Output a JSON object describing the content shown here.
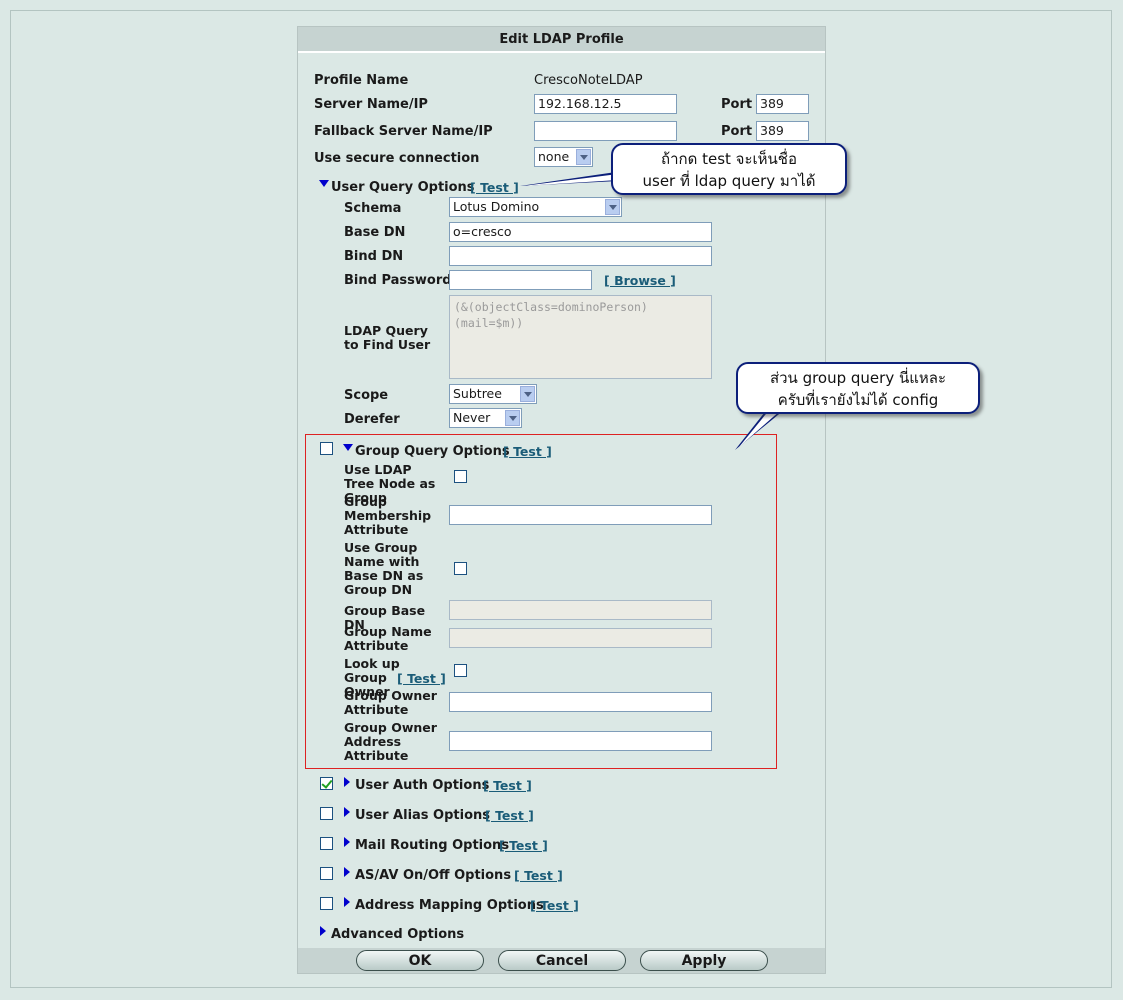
{
  "panel": {
    "title": "Edit LDAP Profile"
  },
  "fields": {
    "profile_name_label": "Profile Name",
    "profile_name_value": "CrescoNoteLDAP",
    "server_label": "Server Name/IP",
    "server_value": "192.168.12.5",
    "port_label": "Port",
    "port_value": "389",
    "fallback_label": "Fallback Server Name/IP",
    "fallback_value": "",
    "fallback_port_label": "Port",
    "fallback_port_value": "389",
    "secure_label": "Use secure connection",
    "secure_value": "none"
  },
  "user_query": {
    "title": "User Query Options",
    "test": "[ Test ]",
    "schema_label": "Schema",
    "schema_value": "Lotus Domino",
    "base_dn_label": "Base DN",
    "base_dn_value": "o=cresco",
    "bind_dn_label": "Bind DN",
    "bind_dn_value": "",
    "bind_pw_label": "Bind Password",
    "bind_pw_value": "",
    "browse": "[ Browse ]",
    "query_label": "LDAP Query to Find User",
    "query_value": "(&(objectClass=dominoPerson)\n(mail=$m))",
    "scope_label": "Scope",
    "scope_value": "Subtree",
    "derefer_label": "Derefer",
    "derefer_value": "Never"
  },
  "group_query": {
    "title": "Group Query Options",
    "test": "[ Test ]",
    "tree_node_label": "Use LDAP Tree Node as Group",
    "membership_label": "Group Membership Attribute",
    "membership_value": "",
    "use_name_label": "Use Group Name with Base DN as Group DN",
    "base_dn_label": "Group Base DN",
    "base_dn_value": "",
    "name_attr_label": "Group Name Attribute",
    "name_attr_value": "",
    "lookup_owner_label": "Look up Group Owner",
    "lookup_owner_test": "[ Test ]",
    "owner_attr_label": "Group Owner Attribute",
    "owner_attr_value": "",
    "owner_addr_label": "Group Owner Address Attribute",
    "owner_addr_value": ""
  },
  "sections": [
    {
      "title": "User Auth Options",
      "test": "[ Test ]",
      "checked": true
    },
    {
      "title": "User Alias Options",
      "test": "[ Test ]",
      "checked": false
    },
    {
      "title": "Mail Routing Options",
      "test": "[ Test ]",
      "checked": false
    },
    {
      "title": "AS/AV On/Off Options",
      "test": "[ Test ]",
      "checked": false
    },
    {
      "title": "Address Mapping Options",
      "test": "[ Test ]",
      "checked": false
    }
  ],
  "advanced": {
    "title": "Advanced Options"
  },
  "buttons": {
    "ok": "OK",
    "cancel": "Cancel",
    "apply": "Apply"
  },
  "callouts": {
    "test_note_line1": "ถ้ากด test จะเห็นชื่อ",
    "test_note_line2": "user ที่ ldap query มาได้",
    "group_note_line1": "ส่วน group query นี่แหละ",
    "group_note_line2": "ครับที่เรายังไม่ได้ config"
  },
  "colors": {
    "background": "#dbe8e5",
    "header": "#c6d3d1",
    "link": "#1a5c78",
    "triangle": "#0000cc",
    "highlight_box": "#dd2222",
    "callout_border": "#0c1f7a"
  },
  "icons": {
    "expanded": "triangle-down-icon",
    "collapsed": "triangle-right-icon",
    "dropdown": "chevron-down-icon"
  }
}
